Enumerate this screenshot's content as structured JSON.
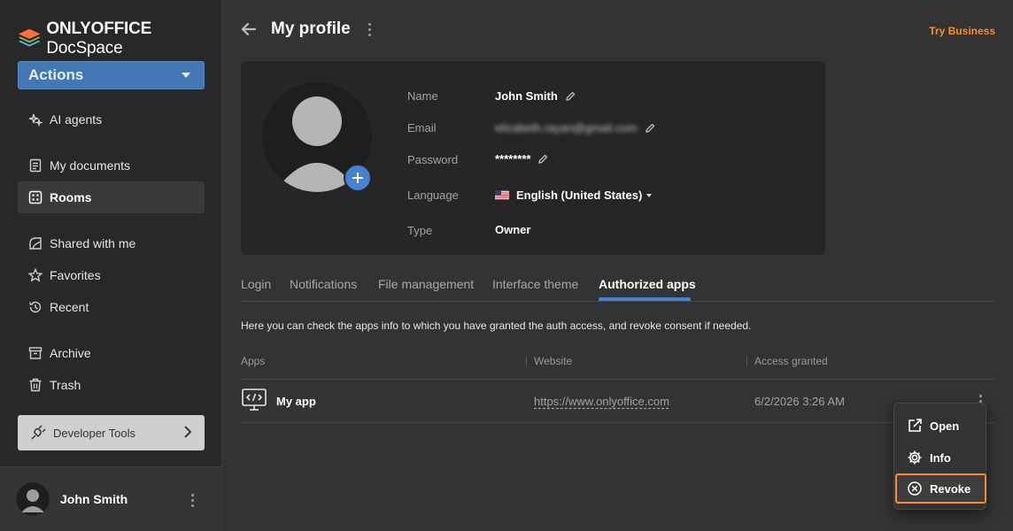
{
  "brand": {
    "bold": "ONLYOFFICE",
    "light": " DocSpace"
  },
  "sidebar": {
    "actions_label": "Actions",
    "items": [
      {
        "label": "AI agents",
        "icon": "ai-agents-icon"
      },
      {
        "label": "My documents",
        "icon": "document-icon"
      },
      {
        "label": "Rooms",
        "icon": "rooms-icon",
        "active": true
      },
      {
        "label": "Shared with me",
        "icon": "shared-icon"
      },
      {
        "label": "Favorites",
        "icon": "star-icon"
      },
      {
        "label": "Recent",
        "icon": "recent-icon"
      },
      {
        "label": "Archive",
        "icon": "archive-icon"
      },
      {
        "label": "Trash",
        "icon": "trash-icon"
      }
    ],
    "developer_tools_label": "Developer Tools",
    "user_name": "John Smith"
  },
  "header": {
    "title": "My profile",
    "try_business": "Try Business"
  },
  "profile": {
    "labels": {
      "name": "Name",
      "email": "Email",
      "password": "Password",
      "language": "Language",
      "type": "Type"
    },
    "name": "John Smith",
    "email": "elizabeth.rayan@gmail.com",
    "password": "********",
    "language": "English (United States)",
    "type": "Owner"
  },
  "tabs": [
    "Login",
    "Notifications",
    "File management",
    "Interface theme",
    "Authorized apps"
  ],
  "active_tab": "Authorized apps",
  "description": "Here you can check the apps info to which you have granted the auth access, and revoke consent if needed.",
  "table": {
    "columns": [
      "Apps",
      "Website",
      "Access granted"
    ],
    "rows": [
      {
        "app": "My app",
        "website": "https://www.onlyoffice.com",
        "granted": "6/2/2026 3:26 AM"
      }
    ]
  },
  "context_menu": {
    "items": [
      {
        "label": "Open",
        "icon": "external-link-icon"
      },
      {
        "label": "Info",
        "icon": "gear-icon"
      },
      {
        "label": "Revoke",
        "icon": "revoke-icon"
      }
    ]
  },
  "colors": {
    "accent": "#4781d1",
    "brand_orange": "#f98e2c",
    "actions_blue": "#4477b5"
  }
}
